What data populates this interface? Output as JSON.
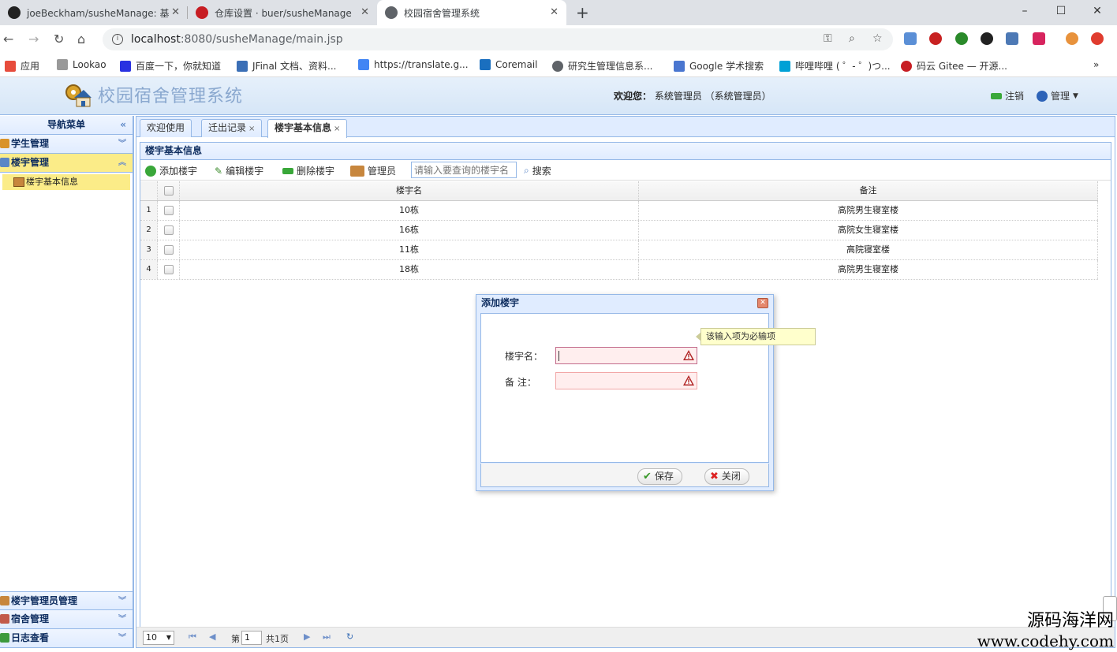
{
  "browser": {
    "tabs": [
      {
        "title": "joeBeckham/susheManage: 基"
      },
      {
        "title": "仓库设置 · buer/susheManage"
      },
      {
        "title": "校园宿舍管理系统"
      }
    ],
    "new_tab": "+",
    "address": {
      "host": "localhost",
      "rest": ":8080/susheManage/main.jsp"
    },
    "bookmarks": [
      "应用",
      "Lookao",
      "百度一下，你就知道",
      "JFinal 文档、资料...",
      "https://translate.g...",
      "Coremail",
      "研究生管理信息系...",
      "Google 学术搜索",
      "哔哩哔哩 ( ゜- ゜)つ...",
      "码云 Gitee — 开源..."
    ],
    "more": "»"
  },
  "app": {
    "title": "校园宿舍管理系统",
    "welcome_label": "欢迎您：",
    "welcome_user": "系统管理员 （系统管理员）",
    "logout": "注销",
    "manage": "管理"
  },
  "nav": {
    "title": "导航菜单",
    "sections": [
      {
        "label": "学生管理"
      },
      {
        "label": "楼宇管理"
      },
      {
        "label": "楼宇管理员管理"
      },
      {
        "label": "宿舍管理"
      },
      {
        "label": "日志查看"
      }
    ],
    "subitem": "楼宇基本信息"
  },
  "tabs": [
    {
      "label": "欢迎使用"
    },
    {
      "label": "迁出记录",
      "close": "×"
    },
    {
      "label": "楼宇基本信息",
      "close": "×"
    }
  ],
  "panel": {
    "title": "楼宇基本信息",
    "toolbar": {
      "add": "添加楼宇",
      "edit": "编辑楼宇",
      "delete": "删除楼宇",
      "manager": "管理员",
      "search_placeholder": "请输入要查询的楼宇名",
      "search": "搜索"
    },
    "columns": [
      "楼宇名",
      "备注"
    ],
    "rows": [
      {
        "n": "1",
        "name": "10栋",
        "note": "高院男生寝室楼"
      },
      {
        "n": "2",
        "name": "16栋",
        "note": "高院女生寝室楼"
      },
      {
        "n": "3",
        "name": "11栋",
        "note": "高院寝室楼"
      },
      {
        "n": "4",
        "name": "18栋",
        "note": "高院男生寝室楼"
      }
    ]
  },
  "pager": {
    "page_size": "10",
    "page_prefix": "第",
    "page_num": "1",
    "total": "共1页"
  },
  "dialog": {
    "title": "添加楼宇",
    "field1_label": "楼宇名：",
    "field2_label": "备 注：",
    "tooltip": "该输入项为必输项",
    "save": "保存",
    "close": "关闭"
  },
  "watermark": {
    "line1": "源码海洋网",
    "line2": "www.codehy.com"
  },
  "colors": {
    "accent_border": "#95b8e7",
    "selected": "#fbec88",
    "panel_header": "#e0ecff"
  }
}
